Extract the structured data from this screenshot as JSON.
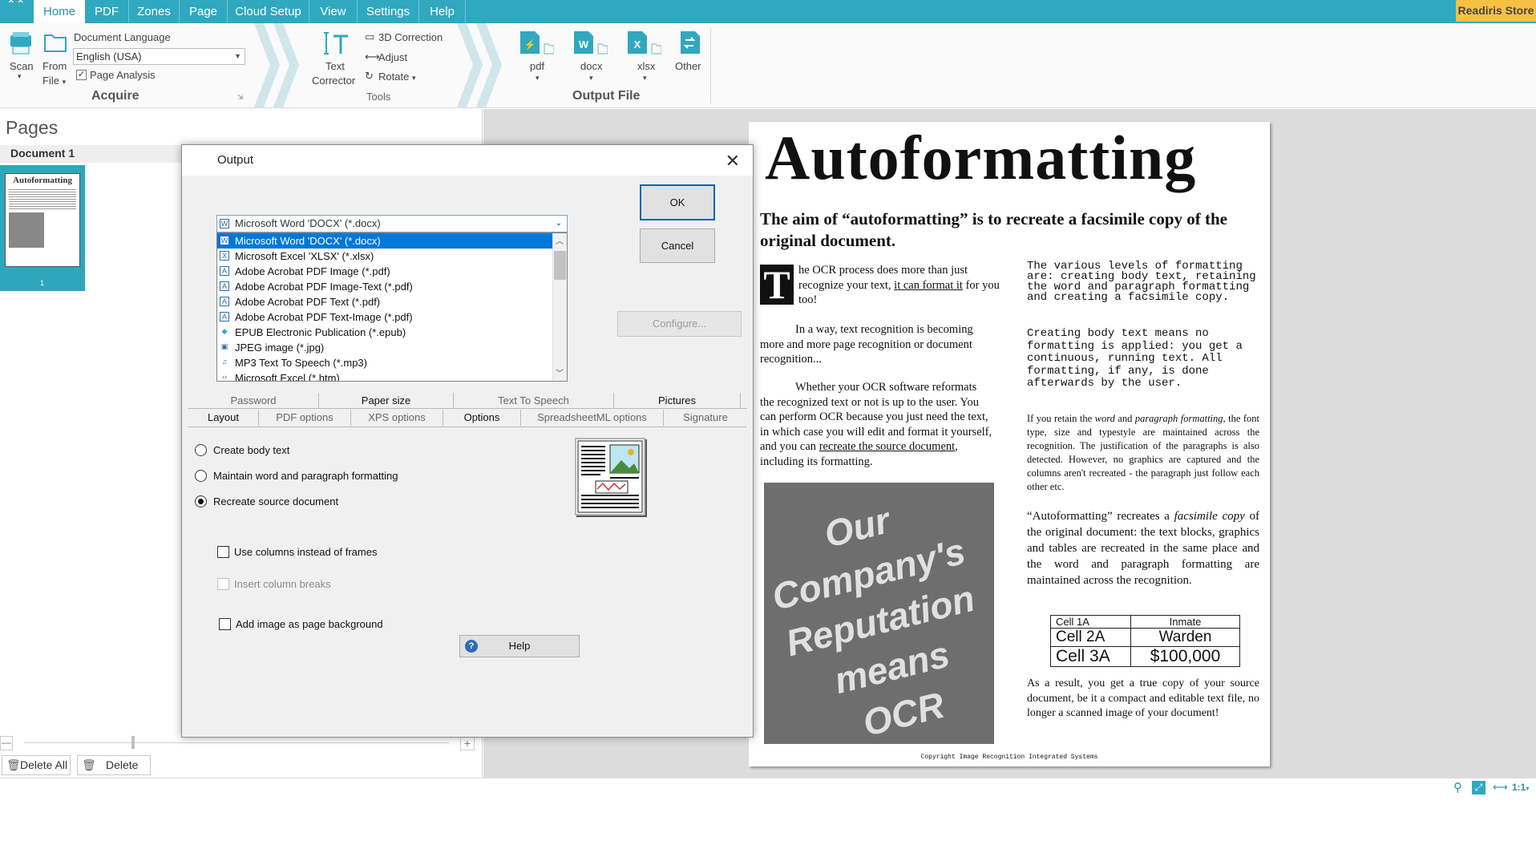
{
  "menubar": {
    "tabs": [
      "Home",
      "PDF",
      "Zones",
      "Page",
      "Cloud Setup",
      "View",
      "Settings",
      "Help"
    ],
    "active_tab": "Home",
    "store_label": "Readiris Store"
  },
  "ribbon": {
    "acquire": {
      "scan_label": "Scan",
      "from_file_label_1": "From",
      "from_file_label_2": "File",
      "doc_language_label": "Document Language",
      "doc_language_value": "English (USA)",
      "page_analysis_label": "Page Analysis",
      "group_title": "Acquire"
    },
    "tools": {
      "text_corrector_1": "Text",
      "text_corrector_2": "Corrector",
      "correction_3d": "3D Correction",
      "adjust": "Adjust",
      "rotate": "Rotate",
      "group_title": "Tools"
    },
    "output": {
      "pdf": "pdf",
      "docx": "docx",
      "xlsx": "xlsx",
      "other": "Other",
      "group_title": "Output File"
    }
  },
  "leftpane": {
    "title": "Pages",
    "document_label": "Document 1",
    "page_number": "1",
    "thumb_title": "Autoformatting",
    "delete_all_label": "Delete All",
    "delete_label": "Delete"
  },
  "dialog": {
    "title": "Output",
    "selected_format": "Microsoft Word 'DOCX' (*.docx)",
    "formats": [
      {
        "label": "Microsoft Word 'DOCX' (*.docx)",
        "icon": "W"
      },
      {
        "label": "Microsoft Excel 'XLSX' (*.xlsx)",
        "icon": "X"
      },
      {
        "label": "Adobe Acrobat PDF Image (*.pdf)",
        "icon": "A"
      },
      {
        "label": "Adobe Acrobat PDF Image-Text (*.pdf)",
        "icon": "A"
      },
      {
        "label": "Adobe Acrobat PDF Text (*.pdf)",
        "icon": "A"
      },
      {
        "label": "Adobe Acrobat PDF Text-Image (*.pdf)",
        "icon": "A"
      },
      {
        "label": "EPUB Electronic Publication (*.epub)",
        "icon": "◆"
      },
      {
        "label": "JPEG image (*.jpg)",
        "icon": "▣"
      },
      {
        "label": "MP3 Text To Speech (*.mp3)",
        "icon": "♫"
      },
      {
        "label": "Microsoft Excel (*.htm)",
        "icon": "‹›"
      }
    ],
    "ok_label": "OK",
    "cancel_label": "Cancel",
    "configure_label": "Configure...",
    "tabs_row1": [
      "Password",
      "Paper size",
      "Text To Speech",
      "Pictures"
    ],
    "tabs_row2": [
      "Layout",
      "PDF options",
      "XPS options",
      "Options",
      "SpreadsheetML options",
      "Signature"
    ],
    "layout_options": {
      "create_body_text": "Create body text",
      "maintain_formatting": "Maintain word and paragraph formatting",
      "recreate_source": "Recreate source document",
      "use_columns": "Use columns instead of frames",
      "insert_column_breaks": "Insert column breaks",
      "add_image_background": "Add image as page background"
    },
    "help_label": "Help"
  },
  "document": {
    "title": "Autoformatting",
    "subtitle": "The aim of “autoformatting” is to recreate a facsimile copy of the original document.",
    "col1_p1_dropcap": "T",
    "col1_p1_a": "he OCR process does more than just recognize your text, ",
    "col1_p1_link": "it can format it",
    "col1_p1_b": " for you too!",
    "col1_p2": "In a way, text recognition is becoming more and more page recognition or document recognition...",
    "col1_p3_a": "Whether your OCR software reformats the recognized text or not is up to the user. You can perform OCR because you just need the text, in which case you will edit and format it yourself, and you can ",
    "col1_p3_link": "recreate the source document",
    "col1_p3_b": ", including its formatting.",
    "image_lines": [
      "Our",
      "Company's",
      "Reputation",
      "means",
      "OCR"
    ],
    "col2_mono1": "The various levels of formatting are: creating body text, retaining the word and paragraph formatting and creating a facsimile copy.",
    "col2_mono2": "Creating body text means no formatting is applied: you get a continuous, running text. All formatting, if any, is done afterwards by the user.",
    "col2_p3_a": "If you retain the ",
    "col2_p3_i1": "word",
    "col2_p3_b": " and ",
    "col2_p3_i2": "paragraph formatting,",
    "col2_p3_c": " the font type, size and typestyle are maintained across the recognition. The justification of the paragraphs is also detected. However, no graphics are captured and the columns aren't recreated - the paragraph just follow each other etc.",
    "col2_p4_a": "“Autoformatting” recreates a ",
    "col2_p4_i": "facsimile copy",
    "col2_p4_b": " of the original document: the text blocks, graphics and tables are recreated in the same place and the word and paragraph formatting are maintained across the recognition.",
    "table": [
      [
        "Cell 1A",
        "Inmate"
      ],
      [
        "Cell 2A",
        "Warden"
      ],
      [
        "Cell 3A",
        "$100,000"
      ]
    ],
    "col2_p5": "As a result, you get a true copy of your source document, be it a compact and editable text file, no longer a scanned image of your document!",
    "footer": "Copyright Image Recognition Integrated Systems"
  },
  "statusbar": {
    "zoom_label": "1:1"
  },
  "colors": {
    "accent": "#2fa8c0",
    "store": "#f6c142",
    "selection": "#0078d7"
  }
}
